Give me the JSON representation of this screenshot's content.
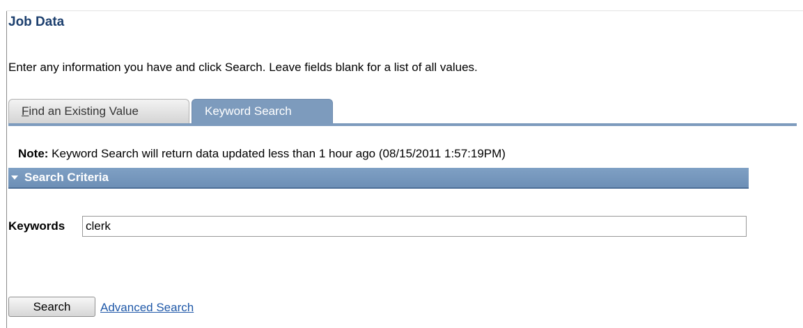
{
  "page": {
    "title": "Job Data",
    "instructions": "Enter any information you have and click Search. Leave fields blank for a list of all values."
  },
  "tabs": [
    {
      "label_accesskey": "F",
      "label_rest": "ind an Existing Value",
      "active": false
    },
    {
      "label": "Keyword Search",
      "active": true
    }
  ],
  "note": {
    "prefix": "Note:",
    "text": " Keyword Search will return data updated less than 1 hour ago (08/15/2011 1:57:19PM)"
  },
  "section": {
    "title": "Search Criteria",
    "icon": "triangle-down-icon"
  },
  "keywords": {
    "label": "Keywords",
    "value": "clerk"
  },
  "actions": {
    "search_label": "Search",
    "advanced_label": "Advanced Search"
  },
  "colors": {
    "title": "#1c3f6e",
    "tab_active": "#7d9bbd",
    "section_header": "#7fa0c4",
    "link": "#1f58a8"
  }
}
